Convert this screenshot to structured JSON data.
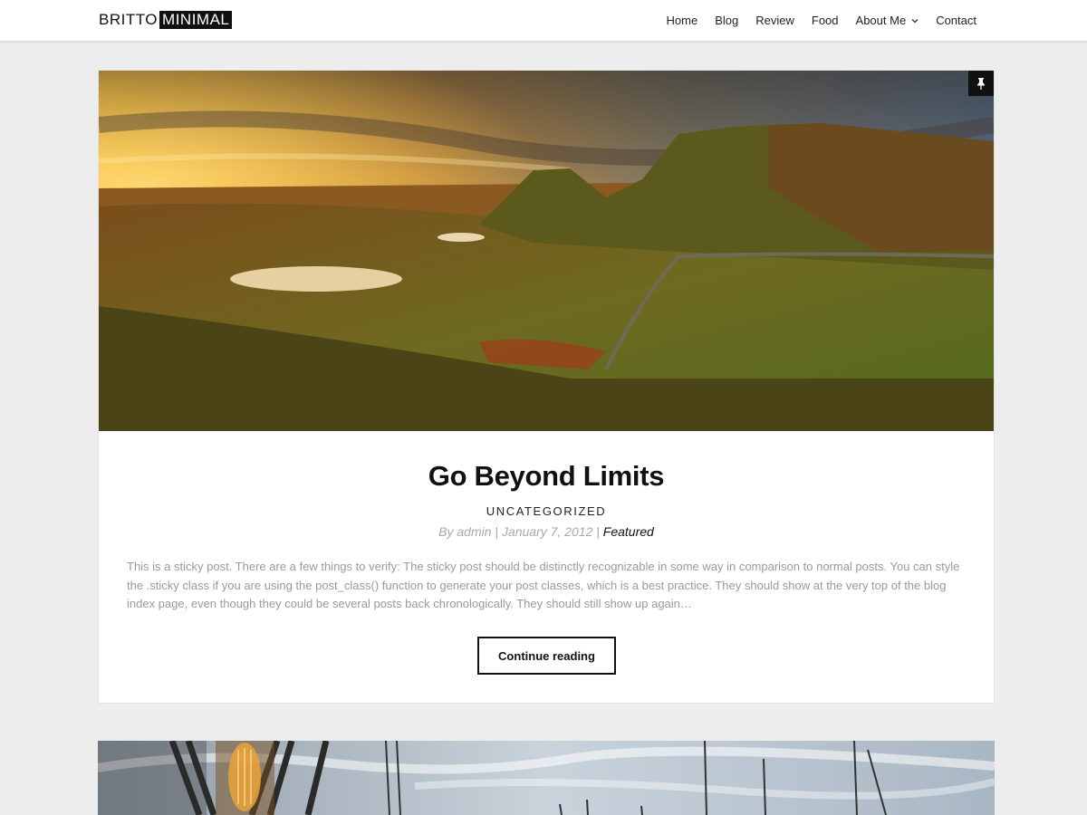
{
  "site": {
    "logo_part1": "BRITTO",
    "logo_part2": "MINIMAL"
  },
  "nav": {
    "items": [
      {
        "label": "Home"
      },
      {
        "label": "Blog"
      },
      {
        "label": "Review"
      },
      {
        "label": "Food"
      },
      {
        "label": "About Me",
        "has_dropdown": true
      },
      {
        "label": "Contact"
      }
    ],
    "dropdown_icon": "chevron-down-icon"
  },
  "post": {
    "title": "Go Beyond Limits",
    "category": "UNCATEGORIZED",
    "meta_by": "By admin",
    "meta_sep1": " | ",
    "meta_date": "January 7, 2012",
    "meta_sep2": " | ",
    "meta_tag": "Featured",
    "excerpt": "This is a sticky post. There are a few things to verify: The sticky post should be distinctly recognizable in some way in comparison to normal posts. You can style the .sticky class if you are using the post_class() function to generate your post classes, which is a best practice. They should show at the very top of the blog index page, even though they could be several posts back chronologically. They should still show up again…",
    "button_label": "Continue reading",
    "sticky_icon": "pin-icon",
    "image": "landscape-photo"
  },
  "next_post": {
    "image": "harbor-lamp-photo"
  },
  "colors": {
    "background": "#ededed",
    "card": "#ffffff",
    "text_dark": "#111111",
    "text_muted": "#9a9a9a"
  }
}
